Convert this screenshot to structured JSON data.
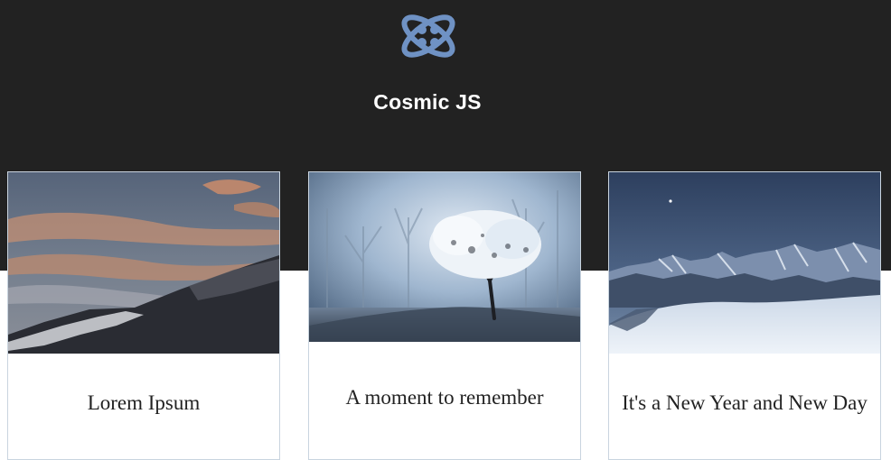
{
  "header": {
    "brand": "Cosmic JS",
    "logo_icon": "cosmic-atom-logo",
    "accent_color": "#6f92c4",
    "background_color": "#222222"
  },
  "cards": [
    {
      "title": "Lorem Ipsum",
      "image": "mountain-sunset-image"
    },
    {
      "title": "A moment to remember",
      "image": "frosted-tree-fog-image"
    },
    {
      "title": "It's a New Year and New Day",
      "image": "snowy-mountain-range-image"
    }
  ]
}
